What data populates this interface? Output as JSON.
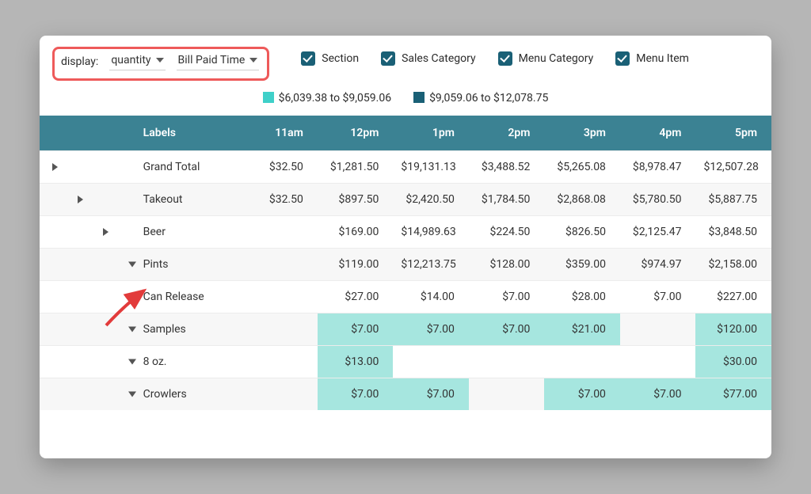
{
  "toolbar": {
    "display_label": "display:",
    "dd1": "quantity",
    "dd2": "Bill Paid Time",
    "checks": [
      "Section",
      "Sales Category",
      "Menu Category",
      "Menu Item"
    ]
  },
  "legend": {
    "range1": "$6,039.38 to $9,059.06",
    "range2": "$9,059.06 to $12,078.75"
  },
  "columns": [
    "Labels",
    "11am",
    "12pm",
    "1pm",
    "2pm",
    "3pm",
    "4pm",
    "5pm"
  ],
  "rows": [
    {
      "indent": 0,
      "chev": "right",
      "label": "Grand Total",
      "cells": [
        "$32.50",
        "$1,281.50",
        "$19,131.13",
        "$3,488.52",
        "$5,265.08",
        "$8,978.47",
        "$12,507.28"
      ],
      "hl": []
    },
    {
      "indent": 1,
      "chev": "right",
      "label": "Takeout",
      "cells": [
        "$32.50",
        "$897.50",
        "$2,420.50",
        "$1,784.50",
        "$2,868.08",
        "$5,780.50",
        "$5,887.75"
      ],
      "hl": []
    },
    {
      "indent": 2,
      "chev": "right",
      "label": "Beer",
      "cells": [
        "",
        "$169.00",
        "$14,989.63",
        "$224.50",
        "$826.50",
        "$2,125.47",
        "$3,848.50"
      ],
      "hl": []
    },
    {
      "indent": 3,
      "chev": "down",
      "label": "Pints",
      "cells": [
        "",
        "$119.00",
        "$12,213.75",
        "$128.00",
        "$359.00",
        "$974.97",
        "$2,158.00"
      ],
      "hl": []
    },
    {
      "indent": 3,
      "chev": "down",
      "label": "Can Release",
      "cells": [
        "",
        "$27.00",
        "$14.00",
        "$7.00",
        "$28.00",
        "$7.00",
        "$227.00"
      ],
      "hl": []
    },
    {
      "indent": 3,
      "chev": "down",
      "label": "Samples",
      "cells": [
        "",
        "$7.00",
        "$7.00",
        "$7.00",
        "$21.00",
        "",
        "$120.00"
      ],
      "hl": [
        1,
        2,
        3,
        4,
        6
      ]
    },
    {
      "indent": 3,
      "chev": "down",
      "label": "8 oz.",
      "cells": [
        "",
        "$13.00",
        "",
        "",
        "",
        "",
        "$30.00"
      ],
      "hl": [
        1,
        6
      ]
    },
    {
      "indent": 3,
      "chev": "down",
      "label": "Crowlers",
      "cells": [
        "",
        "$7.00",
        "$7.00",
        "",
        "$7.00",
        "$7.00",
        "$77.00"
      ],
      "hl": [
        1,
        2,
        4,
        5,
        6
      ]
    }
  ]
}
